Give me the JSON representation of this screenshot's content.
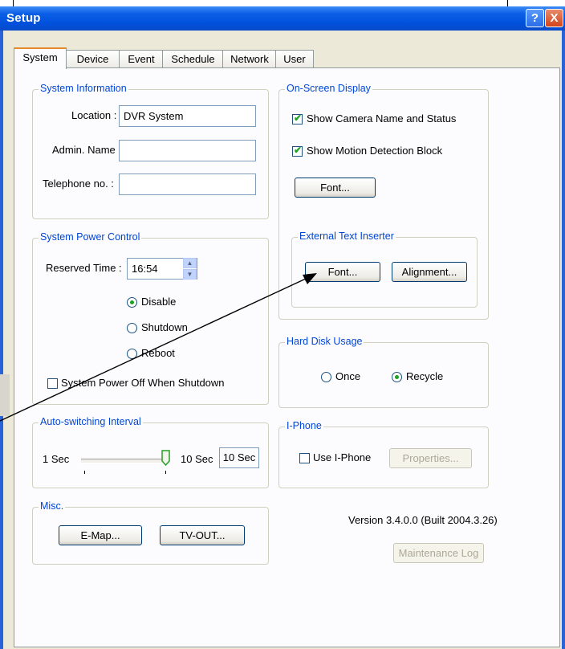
{
  "window": {
    "title": "Setup",
    "help_glyph": "?",
    "close_glyph": "X"
  },
  "tabs": [
    "System",
    "Device",
    "Event",
    "Schedule",
    "Network",
    "User"
  ],
  "system_info": {
    "legend": "System Information",
    "location_label": "Location :",
    "location_value": "DVR System",
    "admin_label": "Admin. Name :",
    "admin_value": "",
    "phone_label": "Telephone no. :",
    "phone_value": ""
  },
  "osd": {
    "legend": "On-Screen Display",
    "show_camera": "Show Camera Name and Status",
    "show_camera_checked": true,
    "show_motion": "Show Motion Detection Block",
    "show_motion_checked": true,
    "font_button": "Font..."
  },
  "ext_text": {
    "legend": "External Text Inserter",
    "font_button": "Font...",
    "alignment_button": "Alignment..."
  },
  "power": {
    "legend": "System Power Control",
    "reserved_label": "Reserved Time :",
    "reserved_value": "16:54",
    "options": [
      "Disable",
      "Shutdown",
      "Reboot"
    ],
    "selected": "Disable",
    "poweroff_label": "System Power Off When Shutdown",
    "poweroff_checked": false
  },
  "hdd": {
    "legend": "Hard Disk Usage",
    "options": [
      "Once",
      "Recycle"
    ],
    "selected": "Recycle"
  },
  "auto_switch": {
    "legend": "Auto-switching Interval",
    "min_label": "1 Sec",
    "max_label": "10 Sec",
    "value_text": "10 Sec",
    "level_fraction": 1.0
  },
  "iphone": {
    "legend": "I-Phone",
    "use_label": "Use I-Phone",
    "use_checked": false,
    "properties_button": "Properties..."
  },
  "misc": {
    "legend": "Misc.",
    "emap_button": "E-Map...",
    "tvout_button": "TV-OUT..."
  },
  "version_text": "Version 3.4.0.0 (Built  2004.3.26)",
  "maintenance_button": "Maintenance Log"
}
